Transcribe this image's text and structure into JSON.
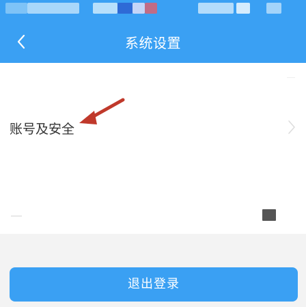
{
  "colors": {
    "primary": "#3aa0f3",
    "background": "#f3f3f3",
    "surface": "#ffffff",
    "text": "#333333",
    "annotation_arrow": "#c0392b"
  },
  "status_bar": {
    "note": ""
  },
  "header": {
    "title": "系统设置",
    "back_icon": "chevron-left-icon"
  },
  "settings": {
    "items": [
      {
        "label": "账号及安全",
        "icon": "chevron-right-icon"
      }
    ]
  },
  "footer": {
    "logout_label": "退出登录"
  }
}
